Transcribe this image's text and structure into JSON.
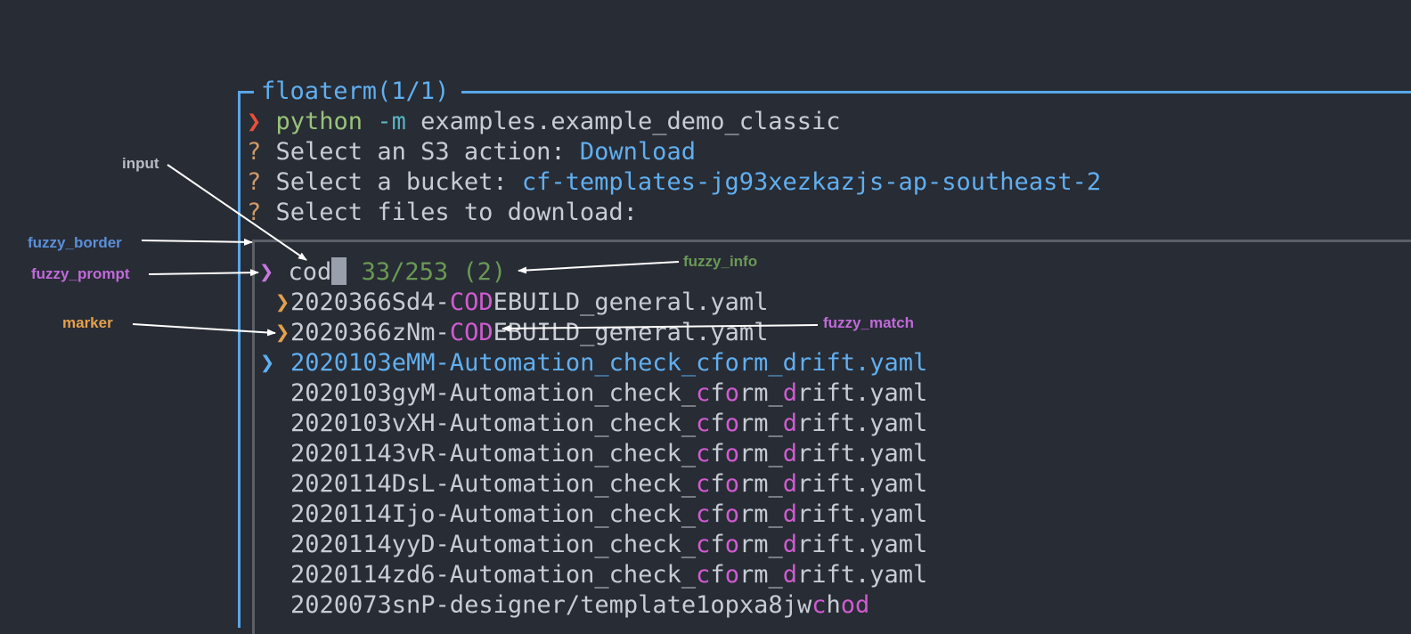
{
  "terminal": {
    "title": "floaterm(1/1)",
    "command": {
      "prompt_symbol": "❯",
      "program": "python",
      "flag": "-m",
      "argument": "examples.example_demo_classic"
    },
    "questions": [
      {
        "mark": "?",
        "text": "Select an S3 action: ",
        "answer": "Download"
      },
      {
        "mark": "?",
        "text": "Select a bucket: ",
        "answer": "cf-templates-jg93xezkazjs-ap-southeast-2"
      },
      {
        "mark": "?",
        "text": "Select files to download:",
        "answer": ""
      }
    ]
  },
  "fuzzy": {
    "prompt_symbol": "❯",
    "input_value": "cod",
    "info": "33/253 (2)",
    "marker_symbol": "❯",
    "pointer_symbol": "❯",
    "items": [
      {
        "marked": true,
        "current": false,
        "segments": [
          [
            "2020366Sd4-",
            false
          ],
          [
            "COD",
            true
          ],
          [
            "EBUILD_general.yaml",
            false
          ]
        ]
      },
      {
        "marked": true,
        "current": false,
        "segments": [
          [
            "2020366zNm-",
            false
          ],
          [
            "COD",
            true
          ],
          [
            "EBUILD_general.yaml",
            false
          ]
        ]
      },
      {
        "marked": false,
        "current": true,
        "segments": [
          [
            "2020103eMM-Automation_check_cform_drift.yaml",
            false
          ]
        ]
      },
      {
        "marked": false,
        "current": false,
        "segments": [
          [
            "2020103gyM-Automation_check_",
            false
          ],
          [
            "c",
            true
          ],
          [
            "f",
            false
          ],
          [
            "o",
            true
          ],
          [
            "rm_",
            false
          ],
          [
            "d",
            true
          ],
          [
            "rift.yaml",
            false
          ]
        ]
      },
      {
        "marked": false,
        "current": false,
        "segments": [
          [
            "2020103vXH-Automation_check_",
            false
          ],
          [
            "c",
            true
          ],
          [
            "f",
            false
          ],
          [
            "o",
            true
          ],
          [
            "rm_",
            false
          ],
          [
            "d",
            true
          ],
          [
            "rift.yaml",
            false
          ]
        ]
      },
      {
        "marked": false,
        "current": false,
        "segments": [
          [
            "20201143vR-Automation_check_",
            false
          ],
          [
            "c",
            true
          ],
          [
            "f",
            false
          ],
          [
            "o",
            true
          ],
          [
            "rm_",
            false
          ],
          [
            "d",
            true
          ],
          [
            "rift.yaml",
            false
          ]
        ]
      },
      {
        "marked": false,
        "current": false,
        "segments": [
          [
            "2020114DsL-Automation_check_",
            false
          ],
          [
            "c",
            true
          ],
          [
            "f",
            false
          ],
          [
            "o",
            true
          ],
          [
            "rm_",
            false
          ],
          [
            "d",
            true
          ],
          [
            "rift.yaml",
            false
          ]
        ]
      },
      {
        "marked": false,
        "current": false,
        "segments": [
          [
            "2020114Ijo-Automation_check_",
            false
          ],
          [
            "c",
            true
          ],
          [
            "f",
            false
          ],
          [
            "o",
            true
          ],
          [
            "rm_",
            false
          ],
          [
            "d",
            true
          ],
          [
            "rift.yaml",
            false
          ]
        ]
      },
      {
        "marked": false,
        "current": false,
        "segments": [
          [
            "2020114yyD-Automation_check_",
            false
          ],
          [
            "c",
            true
          ],
          [
            "f",
            false
          ],
          [
            "o",
            true
          ],
          [
            "rm_",
            false
          ],
          [
            "d",
            true
          ],
          [
            "rift.yaml",
            false
          ]
        ]
      },
      {
        "marked": false,
        "current": false,
        "segments": [
          [
            "2020114zd6-Automation_check_",
            false
          ],
          [
            "c",
            true
          ],
          [
            "f",
            false
          ],
          [
            "o",
            true
          ],
          [
            "rm_",
            false
          ],
          [
            "d",
            true
          ],
          [
            "rift.yaml",
            false
          ]
        ]
      },
      {
        "marked": false,
        "current": false,
        "segments": [
          [
            "2020073snP-designer/template1opxa8jw",
            false
          ],
          [
            "c",
            true
          ],
          [
            "h",
            false
          ],
          [
            "o",
            true
          ],
          [
            "d",
            true
          ]
        ]
      }
    ]
  },
  "annotations": {
    "input": {
      "label": "input",
      "color": "#b9bcc2"
    },
    "fuzzy_border": {
      "label": "fuzzy_border",
      "color": "#5b8fd9"
    },
    "fuzzy_prompt": {
      "label": "fuzzy_prompt",
      "color": "#c06ad9"
    },
    "marker": {
      "label": "marker",
      "color": "#e5a04c"
    },
    "fuzzy_info": {
      "label": "fuzzy_info",
      "color": "#6a9955"
    },
    "fuzzy_match": {
      "label": "fuzzy_match",
      "color": "#c06ad9"
    }
  }
}
